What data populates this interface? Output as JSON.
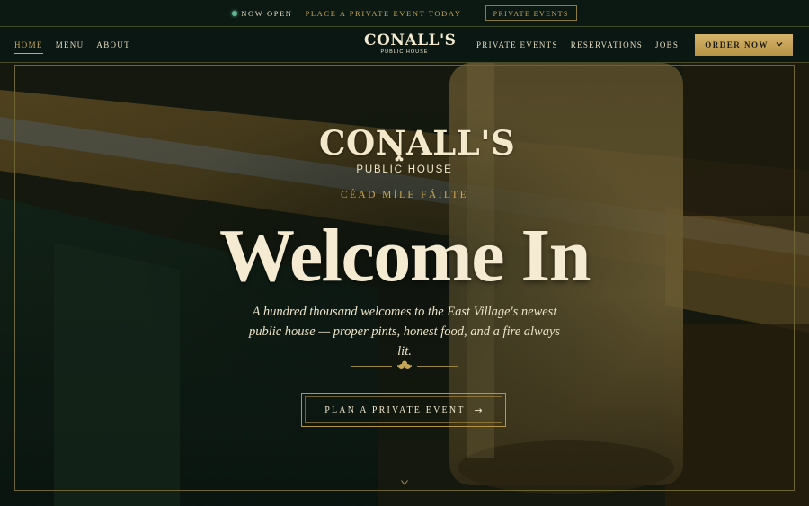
{
  "colors": {
    "accent_gold": "#c8a95b",
    "cream": "#f2e9cf",
    "dark_green": "#0c1913",
    "status_green": "#5fb48c"
  },
  "topbar": {
    "status_label": "NOW OPEN",
    "promo_text": "PLACE A PRIVATE EVENT TODAY",
    "promo_button": "PRIVATE EVENTS"
  },
  "nav": {
    "left_links": [
      {
        "label": "HOME",
        "active": true
      },
      {
        "label": "MENU",
        "active": false
      },
      {
        "label": "ABOUT",
        "active": false
      }
    ],
    "logo": {
      "wordmark": "CONALL'S",
      "sub": "PUBLIC HOUSE"
    },
    "right_links": [
      {
        "label": "PRIVATE EVENTS"
      },
      {
        "label": "RESERVATIONS"
      },
      {
        "label": "JOBS"
      }
    ],
    "order_button": "ORDER NOW",
    "order_icon": "chevron-down-icon"
  },
  "hero": {
    "logo": {
      "wordmark": "CONALL'S",
      "sub": "PUBLIC HOUSE"
    },
    "greeting": "CÉAD MÍLE FÁILTE",
    "headline": "Welcome In",
    "tagline": "A hundred thousand welcomes to the East Village's newest public house — proper pints, honest food, and a fire always lit.",
    "cta_label": "PLAN A PRIVATE EVENT",
    "cta_arrow": "→",
    "scroll_icon": "chevron-down-icon",
    "divider_icon": "shamrock-icon"
  }
}
